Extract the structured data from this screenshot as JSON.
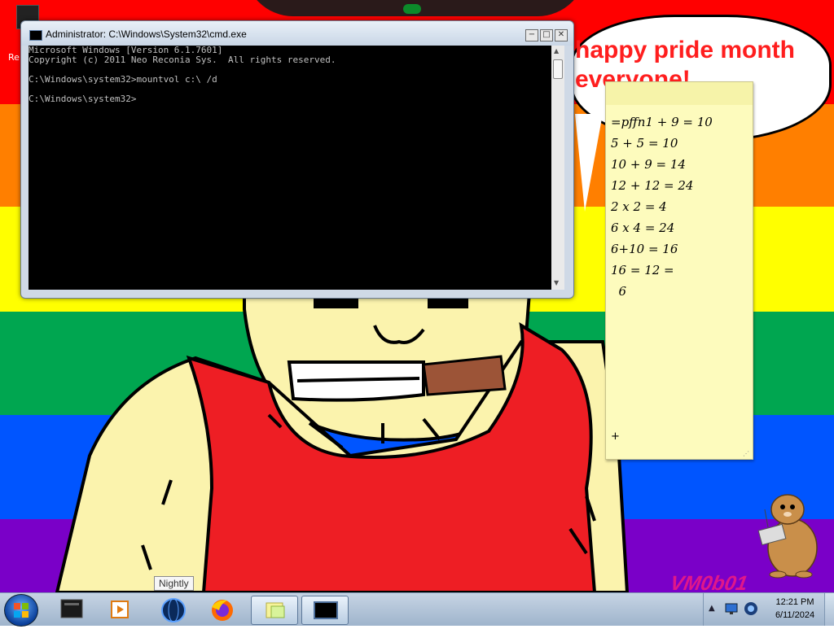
{
  "desktop": {
    "icon_label": "Re",
    "speech_bubble_lines": [
      "happy pride month",
      "everyone!"
    ],
    "watermark": "VM0b01"
  },
  "cmd_window": {
    "title": "Administrator: C:\\Windows\\System32\\cmd.exe",
    "lines": [
      "Microsoft Windows [Version 6.1.7601]",
      "Copyright (c) 2011 Neo Reconia Sys.  All rights reserved.",
      "",
      "C:\\Windows\\system32>mountvol c:\\ /d",
      "",
      "C:\\Windows\\system32>"
    ],
    "buttons": {
      "minimize": "−",
      "maximize": "□",
      "close": "✕"
    }
  },
  "sticky_note": {
    "lines": [
      "=pffn1 + 9 = 10",
      "5 + 5 = 10",
      "10 + 9 = 14",
      "12 + 12 = 24",
      "2 x 2 = 4",
      "6 x 4 = 24",
      "6+10 = 16",
      "16 = 12 =",
      "  6"
    ],
    "add_label": "+"
  },
  "taskbar": {
    "items": [
      {
        "name": "terminal-app",
        "icon": "terminal-icon"
      },
      {
        "name": "media-player",
        "icon": "media-player-icon"
      },
      {
        "name": "nightly-browser",
        "icon": "globe-icon"
      },
      {
        "name": "firefox",
        "icon": "firefox-icon"
      },
      {
        "name": "sticky-notes",
        "icon": "sticky-notes-icon",
        "active": true
      },
      {
        "name": "cmd",
        "icon": "cmd-icon",
        "active": true
      }
    ],
    "tooltip": "Nightly",
    "clock_time": "12:21 PM",
    "clock_date": "6/11/2024"
  },
  "colors": {
    "rainbow": [
      "#ff0000",
      "#ff7f00",
      "#ffff00",
      "#00a650",
      "#0055ff",
      "#7a00c8"
    ],
    "speech_text": "#ff1e1e",
    "sticky_bg": "#fdfbbd",
    "watermark": "#e0178a"
  }
}
